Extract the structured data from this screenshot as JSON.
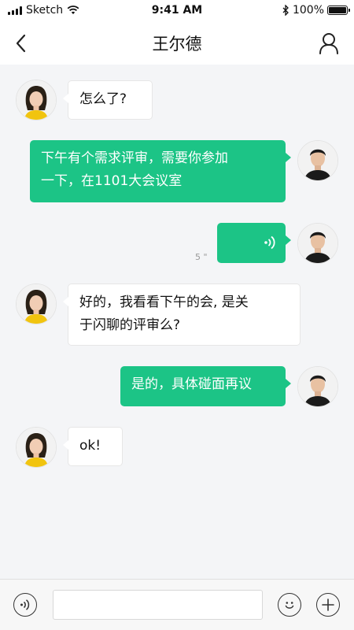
{
  "status_bar": {
    "carrier": "Sketch",
    "time": "9:41 AM",
    "battery": "100%"
  },
  "nav": {
    "back_icon": "chevron-left-icon",
    "title": "王尔德",
    "profile_icon": "user-icon"
  },
  "messages": [
    {
      "side": "left",
      "type": "text",
      "text": "怎么了?"
    },
    {
      "side": "right",
      "type": "text",
      "line1": "下午有个需求评审，需要你参加",
      "line2": "一下，在1101大会议室"
    },
    {
      "side": "right",
      "type": "voice",
      "duration": "5 \"",
      "icon": "sound-wave-icon"
    },
    {
      "side": "left",
      "type": "text",
      "line1": "好的，我看看下午的会, 是关",
      "line2": "于闪聊的评审么?"
    },
    {
      "side": "right",
      "type": "text",
      "text": "是的，具体碰面再议"
    },
    {
      "side": "left",
      "type": "text",
      "text": "ok!"
    }
  ],
  "input_bar": {
    "voice_icon": "voice-input-icon",
    "input_value": "",
    "input_placeholder": "",
    "emoji_icon": "smiley-icon",
    "add_icon": "plus-icon"
  },
  "colors": {
    "accent_green": "#1cc486",
    "background": "#f4f5f7"
  }
}
